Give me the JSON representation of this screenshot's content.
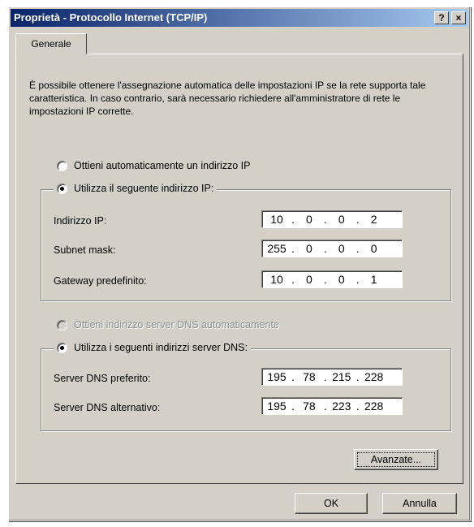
{
  "window": {
    "title": "Proprietà - Protocollo Internet (TCP/IP)",
    "help_button": "?",
    "close_button": "×"
  },
  "tabs": [
    {
      "label": "Generale"
    }
  ],
  "intro_text": "È possibile ottenere l'assegnazione automatica delle impostazioni IP se la rete supporta tale caratteristica. In caso contrario, sarà necessario richiedere all'amministratore di rete le impostazioni IP corrette.",
  "ip": {
    "auto_option": "Ottieni automaticamente un indirizzo IP",
    "manual_option": "Utilizza il seguente indirizzo IP:",
    "selected": "manual",
    "fields": [
      {
        "label": "Indirizzo IP:",
        "octets": [
          "10",
          "0",
          "0",
          "2"
        ]
      },
      {
        "label": "Subnet mask:",
        "octets": [
          "255",
          "0",
          "0",
          "0"
        ]
      },
      {
        "label": "Gateway predefinito:",
        "octets": [
          "10",
          "0",
          "0",
          "1"
        ]
      }
    ]
  },
  "dns": {
    "auto_option": "Ottieni indirizzo server DNS automaticamente",
    "manual_option": "Utilizza i seguenti indirizzi server DNS:",
    "selected": "manual",
    "fields": [
      {
        "label": "Server DNS preferito:",
        "octets": [
          "195",
          "78",
          "215",
          "228"
        ]
      },
      {
        "label": "Server DNS alternativo:",
        "octets": [
          "195",
          "78",
          "223",
          "228"
        ]
      }
    ]
  },
  "buttons": {
    "advanced": "Avanzate...",
    "ok": "OK",
    "cancel": "Annulla"
  }
}
